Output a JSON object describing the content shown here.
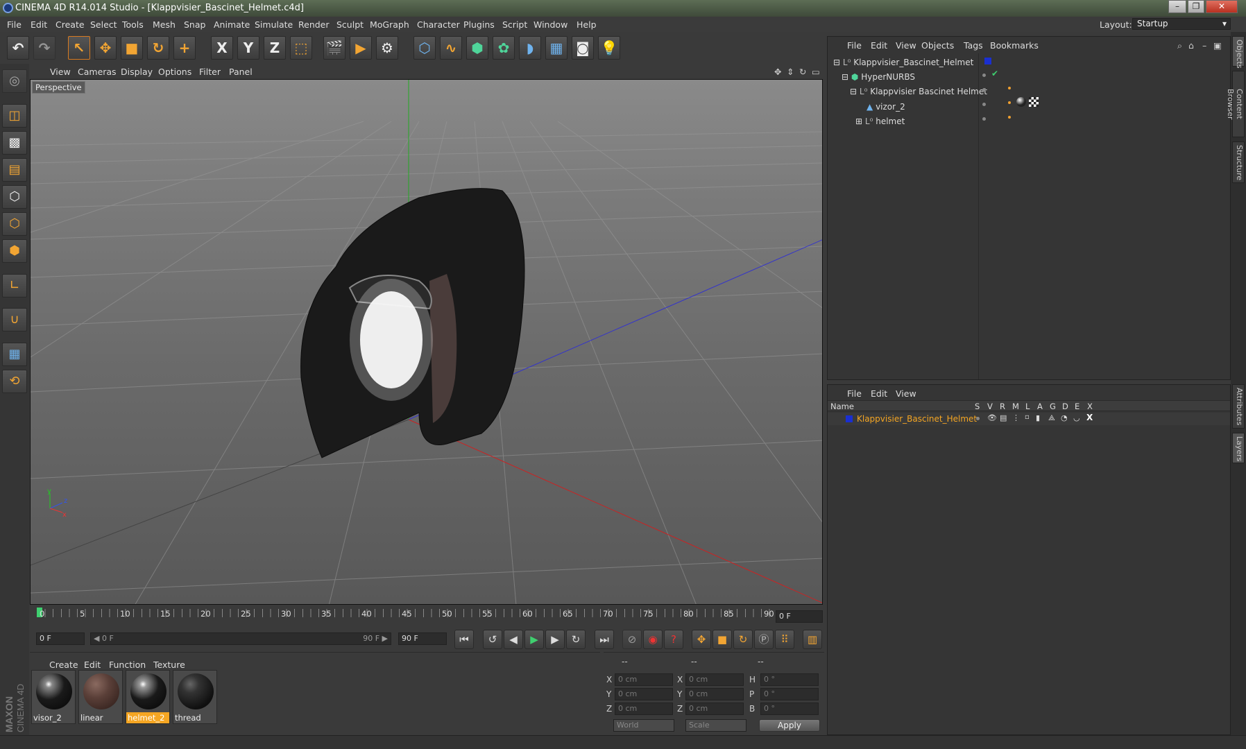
{
  "titlebar": {
    "title": "CINEMA 4D R14.014 Studio - [Klappvisier_Bascinet_Helmet.c4d]"
  },
  "menubar": {
    "items": [
      "File",
      "Edit",
      "Create",
      "Select",
      "Tools",
      "Mesh",
      "Snap",
      "Animate",
      "Simulate",
      "Render",
      "Sculpt",
      "MoGraph",
      "Character",
      "Plugins",
      "Script",
      "Window",
      "Help"
    ],
    "layout_label": "Layout:",
    "layout_value": "Startup"
  },
  "toolbar": {
    "undo": "↶",
    "redo": "↷",
    "x_label": "X",
    "y_label": "Y",
    "z_label": "Z"
  },
  "viewport": {
    "menu": [
      "View",
      "Cameras",
      "Display",
      "Options",
      "Filter",
      "Panel"
    ],
    "label": "Perspective",
    "axis_y": "y",
    "axis_z": "z",
    "axis_x": "x"
  },
  "timeline": {
    "ticks": [
      "0",
      "5",
      "10",
      "15",
      "20",
      "25",
      "30",
      "35",
      "40",
      "45",
      "50",
      "55",
      "60",
      "65",
      "70",
      "75",
      "80",
      "85",
      "90"
    ],
    "current_frame": "0 F",
    "start_field": "0 F",
    "range_start": "◀ 0 F",
    "range_end": "90 F ▶",
    "end_field": "90 F"
  },
  "materials": {
    "menu": [
      "Create",
      "Edit",
      "Function",
      "Texture"
    ],
    "items": [
      {
        "name": "visor_2",
        "selected": false,
        "color": "#1a1a1a"
      },
      {
        "name": "linear",
        "selected": false,
        "color": "#5a3f38"
      },
      {
        "name": "helmet_2",
        "selected": true,
        "color": "#1a1a1a"
      },
      {
        "name": "thread",
        "selected": false,
        "color": "#222222"
      }
    ]
  },
  "coordinates": {
    "headers": [
      "--",
      "--",
      "--"
    ],
    "rows": [
      {
        "a": "X",
        "av": "0 cm",
        "b": "X",
        "bv": "0 cm",
        "c": "H",
        "cv": "0 °"
      },
      {
        "a": "Y",
        "av": "0 cm",
        "b": "Y",
        "bv": "0 cm",
        "c": "P",
        "cv": "0 °"
      },
      {
        "a": "Z",
        "av": "0 cm",
        "b": "Z",
        "bv": "0 cm",
        "c": "B",
        "cv": "0 °"
      }
    ],
    "world": "World",
    "scale": "Scale",
    "apply": "Apply"
  },
  "objects": {
    "menu": [
      "File",
      "Edit",
      "View",
      "Objects",
      "Tags",
      "Bookmarks"
    ],
    "tree": [
      {
        "name": "Klappvisier_Bascinet_Helmet",
        "depth": 0
      },
      {
        "name": "HyperNURBS",
        "depth": 1
      },
      {
        "name": "Klappvisier Bascinet Helmet",
        "depth": 2
      },
      {
        "name": "vizor_2",
        "depth": 3
      },
      {
        "name": "helmet",
        "depth": 3
      }
    ]
  },
  "layers": {
    "menu": [
      "File",
      "Edit",
      "View"
    ],
    "columns": [
      "Name",
      "S",
      "V",
      "R",
      "M",
      "L",
      "A",
      "G",
      "D",
      "E",
      "X"
    ],
    "rows": [
      {
        "name": "Klappvisier_Bascinet_Helmet",
        "color": "#1a2fd0"
      }
    ]
  },
  "sidetabs": [
    "Objects",
    "Content Browser",
    "Structure",
    "Attributes",
    "Layers"
  ],
  "colors": {
    "accent": "#f0a030",
    "selection": "#f5a623",
    "layer_blue": "#1a2fd0"
  }
}
